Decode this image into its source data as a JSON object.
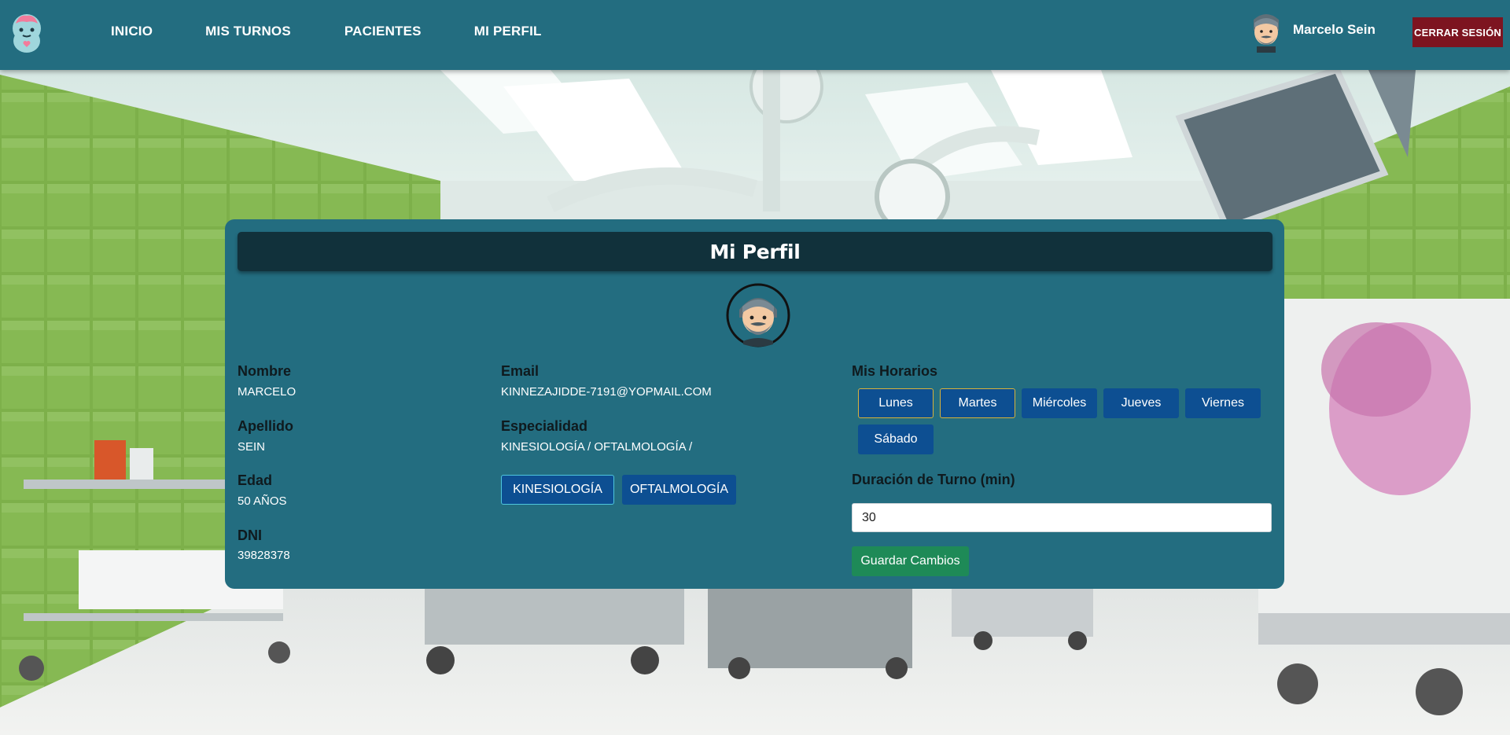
{
  "navbar": {
    "links": [
      "INICIO",
      "MIS TURNOS",
      "PACIENTES",
      "MI PERFIL"
    ],
    "user_name": "Marcelo Sein",
    "logout_label": "CERRAR SESIÓN"
  },
  "profile": {
    "title": "Mi Perfil",
    "fields": {
      "nombre": {
        "label": "Nombre",
        "value": "MARCELO"
      },
      "apellido": {
        "label": "Apellido",
        "value": "SEIN"
      },
      "edad": {
        "label": "Edad",
        "value": "50 AÑOS"
      },
      "dni": {
        "label": "DNI",
        "value": "39828378"
      },
      "email": {
        "label": "Email",
        "value": "KINNEZAJIDDE-7191@YOPMAIL.COM"
      },
      "especialidad": {
        "label": "Especialidad",
        "value": "KINESIOLOGÍA / OFTALMOLOGÍA /"
      }
    },
    "specialty_buttons": [
      "KINESIOLOGÍA",
      "OFTALMOLOGÍA"
    ],
    "schedule": {
      "label": "Mis Horarios",
      "days": [
        "Lunes",
        "Martes",
        "Miércoles",
        "Jueves",
        "Viernes",
        "Sábado"
      ]
    },
    "duration": {
      "label": "Duración de Turno (min)",
      "value": "30"
    },
    "save_label": "Guardar Cambios"
  },
  "colors": {
    "navbar": "#236d80",
    "card": "#236d80",
    "card_header": "#11313b",
    "button_blue": "#0d4f92",
    "logout_red": "#7d1420",
    "save_green": "#1e8a57"
  },
  "icons": {
    "logo": "brain-mascot-icon",
    "user_avatar": "bearded-man-avatar-icon"
  }
}
